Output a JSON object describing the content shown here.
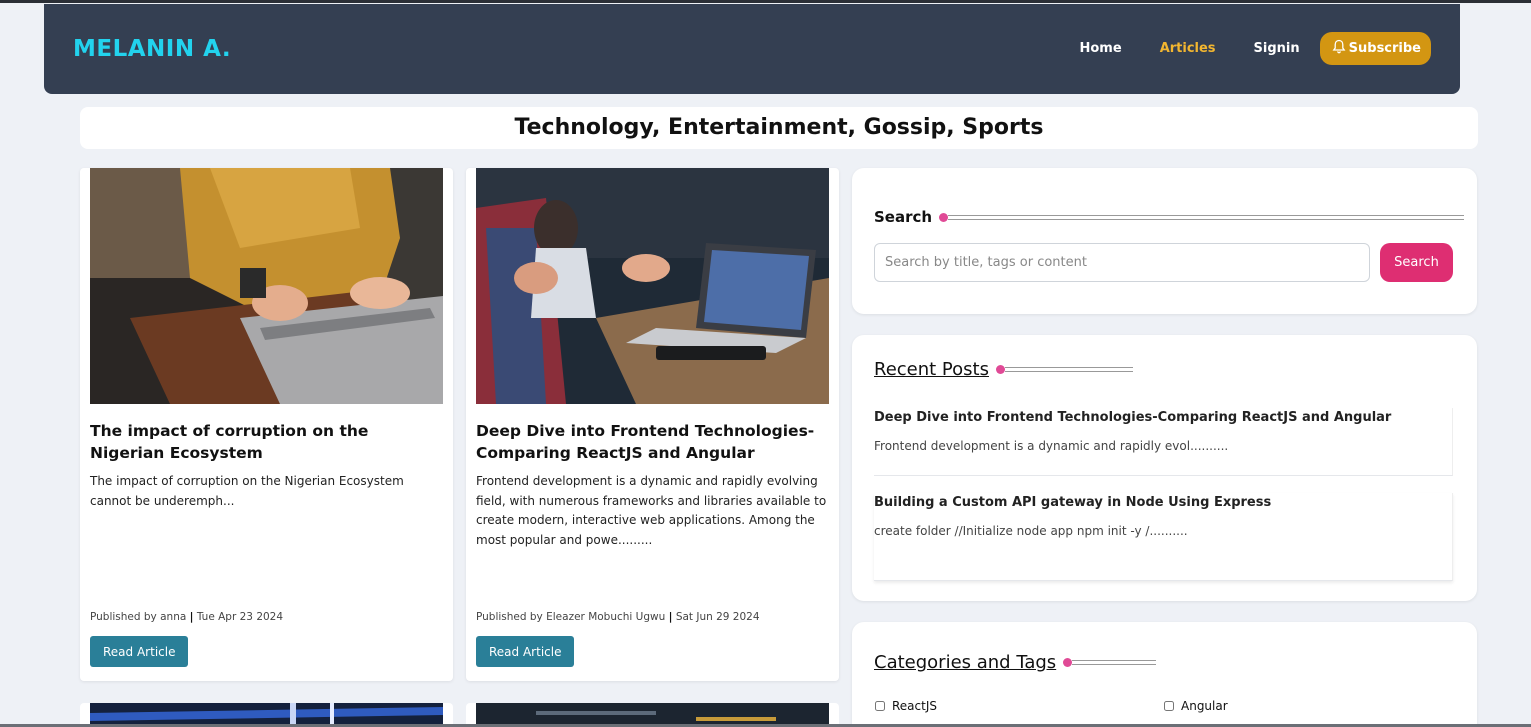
{
  "header": {
    "brand": "MELANIN A.",
    "nav": {
      "home": "Home",
      "articles": "Articles",
      "signin": "Signin",
      "subscribe": "Subscribe"
    },
    "colors": {
      "brand": "#22d3ee",
      "active": "#f2b630",
      "subscribe_bg": "#d39612",
      "header_bg": "#343f52"
    }
  },
  "page_title": "Technology, Entertainment, Gossip, Sports",
  "articles": [
    {
      "title": "The impact of corruption on the Nigerian Ecosystem",
      "excerpt": "The impact of corruption on the Nigerian Ecosystem cannot be underemph...",
      "published_prefix": "Published by",
      "author": "anna",
      "separator": "|",
      "date": "Tue Apr 23 2024",
      "read_label": "Read Article"
    },
    {
      "title": "Deep Dive into Frontend Technologies-Comparing ReactJS and Angular",
      "excerpt": "Frontend development is a dynamic and rapidly evolving field, with numerous frameworks and libraries available to create modern, interactive web applications. Among the most popular and powe.........",
      "published_prefix": "Published by",
      "author": "Eleazer Mobuchi Ugwu",
      "separator": "|",
      "date": "Sat Jun 29 2024",
      "read_label": "Read Article"
    }
  ],
  "sidebar": {
    "search": {
      "title": "Search",
      "placeholder": "Search by title, tags or content",
      "button": "Search"
    },
    "recent": {
      "title": "Recent Posts",
      "posts": [
        {
          "title": "Deep Dive into Frontend Technologies-Comparing ReactJS and Angular",
          "excerpt": "Frontend development is a dynamic and rapidly evol.........."
        },
        {
          "title": "Building a Custom API gateway in Node Using Express",
          "excerpt": "create folder //Initialize node app npm init -y /.........."
        }
      ]
    },
    "categories": {
      "title": "Categories and Tags",
      "tags": [
        "ReactJS",
        "Angular"
      ]
    },
    "accent": "#e04a96",
    "search_button_color": "#de2e72"
  }
}
